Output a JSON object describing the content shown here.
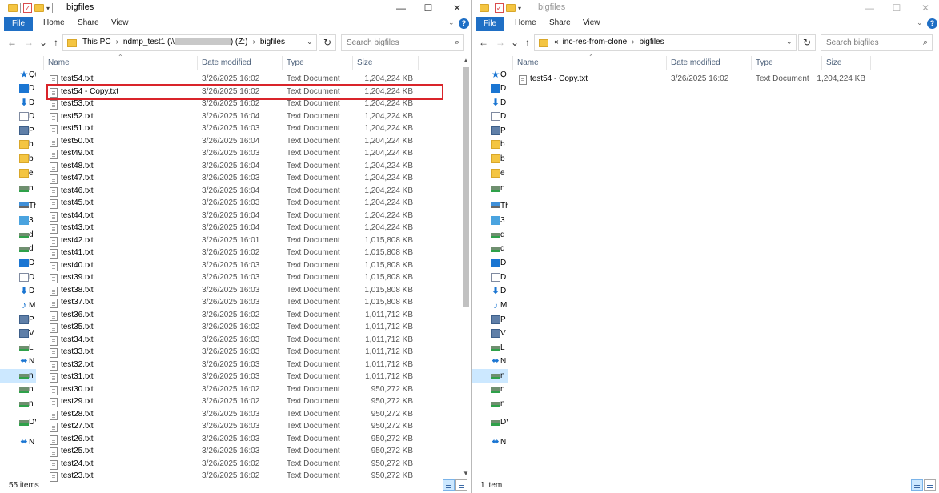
{
  "left_window": {
    "title": "bigfiles",
    "controls": {
      "minimize": "—",
      "maximize": "☐",
      "close": "✕"
    },
    "ribbon": {
      "file": "File",
      "tabs": [
        "Home",
        "Share",
        "View"
      ],
      "help": "?"
    },
    "address": {
      "this_pc": "This PC",
      "share_before": "ndmp_test1 (\\\\",
      "share_after": ") (Z:)",
      "folder": "bigfiles"
    },
    "search_placeholder": "Search bigfiles",
    "columns": {
      "name": "Name",
      "date": "Date modified",
      "type": "Type",
      "size": "Size"
    },
    "sidebar": [
      "Qu",
      "D",
      "D",
      "D",
      "P",
      "b",
      "b",
      "e",
      "n",
      "Th",
      "3",
      "d",
      "d",
      "D",
      "D",
      "D",
      "M",
      "P",
      "V",
      "L",
      "N",
      "n",
      "n",
      "n",
      "DV",
      "N"
    ],
    "files": [
      {
        "name": "test54.txt",
        "date": "3/26/2025 16:02",
        "type": "Text Document",
        "size": "1,204,224 KB"
      },
      {
        "name": "test54 - Copy.txt",
        "date": "3/26/2025 16:02",
        "type": "Text Document",
        "size": "1,204,224 KB"
      },
      {
        "name": "test53.txt",
        "date": "3/26/2025 16:02",
        "type": "Text Document",
        "size": "1,204,224 KB"
      },
      {
        "name": "test52.txt",
        "date": "3/26/2025 16:04",
        "type": "Text Document",
        "size": "1,204,224 KB"
      },
      {
        "name": "test51.txt",
        "date": "3/26/2025 16:03",
        "type": "Text Document",
        "size": "1,204,224 KB"
      },
      {
        "name": "test50.txt",
        "date": "3/26/2025 16:04",
        "type": "Text Document",
        "size": "1,204,224 KB"
      },
      {
        "name": "test49.txt",
        "date": "3/26/2025 16:03",
        "type": "Text Document",
        "size": "1,204,224 KB"
      },
      {
        "name": "test48.txt",
        "date": "3/26/2025 16:04",
        "type": "Text Document",
        "size": "1,204,224 KB"
      },
      {
        "name": "test47.txt",
        "date": "3/26/2025 16:03",
        "type": "Text Document",
        "size": "1,204,224 KB"
      },
      {
        "name": "test46.txt",
        "date": "3/26/2025 16:04",
        "type": "Text Document",
        "size": "1,204,224 KB"
      },
      {
        "name": "test45.txt",
        "date": "3/26/2025 16:03",
        "type": "Text Document",
        "size": "1,204,224 KB"
      },
      {
        "name": "test44.txt",
        "date": "3/26/2025 16:04",
        "type": "Text Document",
        "size": "1,204,224 KB"
      },
      {
        "name": "test43.txt",
        "date": "3/26/2025 16:04",
        "type": "Text Document",
        "size": "1,204,224 KB"
      },
      {
        "name": "test42.txt",
        "date": "3/26/2025 16:01",
        "type": "Text Document",
        "size": "1,015,808 KB"
      },
      {
        "name": "test41.txt",
        "date": "3/26/2025 16:02",
        "type": "Text Document",
        "size": "1,015,808 KB"
      },
      {
        "name": "test40.txt",
        "date": "3/26/2025 16:03",
        "type": "Text Document",
        "size": "1,015,808 KB"
      },
      {
        "name": "test39.txt",
        "date": "3/26/2025 16:03",
        "type": "Text Document",
        "size": "1,015,808 KB"
      },
      {
        "name": "test38.txt",
        "date": "3/26/2025 16:03",
        "type": "Text Document",
        "size": "1,015,808 KB"
      },
      {
        "name": "test37.txt",
        "date": "3/26/2025 16:03",
        "type": "Text Document",
        "size": "1,015,808 KB"
      },
      {
        "name": "test36.txt",
        "date": "3/26/2025 16:02",
        "type": "Text Document",
        "size": "1,011,712 KB"
      },
      {
        "name": "test35.txt",
        "date": "3/26/2025 16:02",
        "type": "Text Document",
        "size": "1,011,712 KB"
      },
      {
        "name": "test34.txt",
        "date": "3/26/2025 16:03",
        "type": "Text Document",
        "size": "1,011,712 KB"
      },
      {
        "name": "test33.txt",
        "date": "3/26/2025 16:03",
        "type": "Text Document",
        "size": "1,011,712 KB"
      },
      {
        "name": "test32.txt",
        "date": "3/26/2025 16:03",
        "type": "Text Document",
        "size": "1,011,712 KB"
      },
      {
        "name": "test31.txt",
        "date": "3/26/2025 16:03",
        "type": "Text Document",
        "size": "1,011,712 KB"
      },
      {
        "name": "test30.txt",
        "date": "3/26/2025 16:02",
        "type": "Text Document",
        "size": "950,272 KB"
      },
      {
        "name": "test29.txt",
        "date": "3/26/2025 16:02",
        "type": "Text Document",
        "size": "950,272 KB"
      },
      {
        "name": "test28.txt",
        "date": "3/26/2025 16:03",
        "type": "Text Document",
        "size": "950,272 KB"
      },
      {
        "name": "test27.txt",
        "date": "3/26/2025 16:03",
        "type": "Text Document",
        "size": "950,272 KB"
      },
      {
        "name": "test26.txt",
        "date": "3/26/2025 16:03",
        "type": "Text Document",
        "size": "950,272 KB"
      },
      {
        "name": "test25.txt",
        "date": "3/26/2025 16:03",
        "type": "Text Document",
        "size": "950,272 KB"
      },
      {
        "name": "test24.txt",
        "date": "3/26/2025 16:02",
        "type": "Text Document",
        "size": "950,272 KB"
      },
      {
        "name": "test23.txt",
        "date": "3/26/2025 16:02",
        "type": "Text Document",
        "size": "950,272 KB"
      }
    ],
    "status": "55 items"
  },
  "right_window": {
    "title": "bigfiles",
    "controls": {
      "minimize": "—",
      "maximize": "☐",
      "close": "✕"
    },
    "ribbon": {
      "file": "File",
      "tabs": [
        "Home",
        "Share",
        "View"
      ],
      "help": "?"
    },
    "address": {
      "overflow": "«",
      "parent": "inc-res-from-clone",
      "folder": "bigfiles"
    },
    "search_placeholder": "Search bigfiles",
    "columns": {
      "name": "Name",
      "date": "Date modified",
      "type": "Type",
      "size": "Size"
    },
    "sidebar": [
      "Q",
      "D",
      "D",
      "D",
      "P",
      "b",
      "b",
      "e",
      "n",
      "Th",
      "3",
      "d",
      "d",
      "D",
      "D",
      "D",
      "M",
      "P",
      "V",
      "L",
      "N",
      "n",
      "n",
      "n",
      "DV",
      "N"
    ],
    "files": [
      {
        "name": "test54 - Copy.txt",
        "date": "3/26/2025 16:02",
        "type": "Text Document",
        "size": "1,204,224 KB"
      }
    ],
    "status": "1 item"
  },
  "colors": {
    "accent": "#1f6fc5",
    "highlight_border": "#d9242a",
    "selection": "#cce8ff"
  },
  "highlighted_file": "test54 - Copy.txt"
}
